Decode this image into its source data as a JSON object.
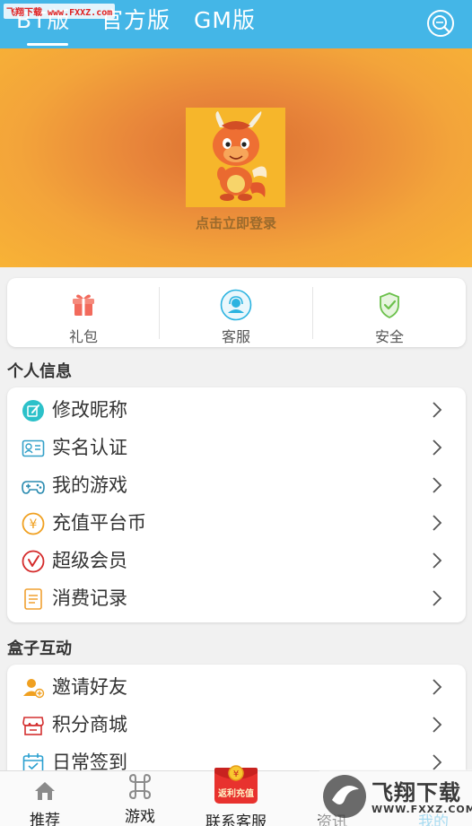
{
  "header": {
    "watermark": "飞翔下载 www.FXXZ.com",
    "tabs": [
      {
        "label": "BT版",
        "active": true
      },
      {
        "label": "官方版",
        "active": false
      },
      {
        "label": "GM版",
        "active": false
      }
    ],
    "search_icon": "search-icon",
    "bg_color": "#44b6e7"
  },
  "banner": {
    "avatar_icon": "dragon-mascot-icon",
    "login_text": "点击立即登录"
  },
  "quick_actions": [
    {
      "label": "礼包",
      "icon": "gift-icon",
      "color": "#f06a5a"
    },
    {
      "label": "客服",
      "icon": "customer-service-icon",
      "color": "#2bb3e0"
    },
    {
      "label": "安全",
      "icon": "shield-check-icon",
      "color": "#6cc14c"
    }
  ],
  "personal_info": {
    "title": "个人信息",
    "items": [
      {
        "label": "修改昵称",
        "icon": "edit-icon",
        "color": "#2cc1c9"
      },
      {
        "label": "实名认证",
        "icon": "id-card-icon",
        "color": "#32a0c8"
      },
      {
        "label": "我的游戏",
        "icon": "gamepad-icon",
        "color": "#2a8bb0"
      },
      {
        "label": "充值平台币",
        "icon": "yen-coin-icon",
        "color": "#f0a020"
      },
      {
        "label": "超级会员",
        "icon": "vip-icon",
        "color": "#d42a2a"
      },
      {
        "label": "消费记录",
        "icon": "receipt-icon",
        "color": "#f0a030"
      }
    ]
  },
  "box_interaction": {
    "title": "盒子互动",
    "items": [
      {
        "label": "邀请好友",
        "icon": "invite-user-icon",
        "color": "#f0a020"
      },
      {
        "label": "积分商城",
        "icon": "store-icon",
        "color": "#d43030"
      },
      {
        "label": "日常签到",
        "icon": "calendar-check-icon",
        "color": "#2aa0d0"
      }
    ]
  },
  "bottom_nav": {
    "items": [
      {
        "label": "推荐",
        "icon": "home-icon"
      },
      {
        "label": "游戏",
        "icon": "command-icon"
      },
      {
        "label": "联系客服",
        "icon": "rebate-recharge-icon",
        "badge_text": "返利充值"
      },
      {
        "label": "资讯",
        "icon": "news-icon"
      },
      {
        "label": "我的",
        "icon": "user-icon"
      }
    ],
    "watermark_text": "飞翔下载",
    "watermark_url": "WWW.FXXZ.COM"
  }
}
